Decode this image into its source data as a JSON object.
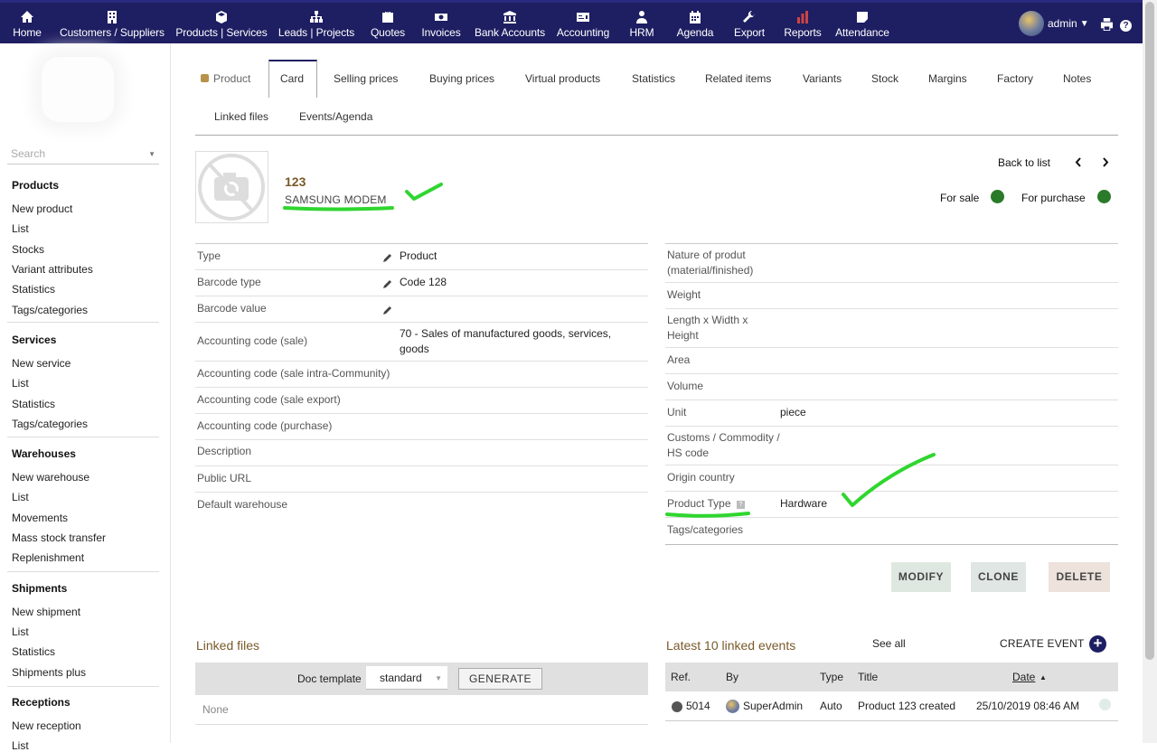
{
  "topnav": {
    "items": [
      {
        "label": "Home",
        "icon": "home-icon"
      },
      {
        "label": "Customers / Suppliers",
        "icon": "building-icon"
      },
      {
        "label": "Products | Services",
        "icon": "cube-icon"
      },
      {
        "label": "Leads | Projects",
        "icon": "sitemap-icon"
      },
      {
        "label": "Quotes",
        "icon": "suitcase-icon"
      },
      {
        "label": "Invoices",
        "icon": "money-bill-icon"
      },
      {
        "label": "Bank Accounts",
        "icon": "bank-icon"
      },
      {
        "label": "Accounting",
        "icon": "dollar-card-icon"
      },
      {
        "label": "HRM",
        "icon": "user-tie-icon"
      },
      {
        "label": "Agenda",
        "icon": "calendar-icon"
      },
      {
        "label": "Export",
        "icon": "wrench-icon"
      },
      {
        "label": "Reports",
        "icon": "chart-icon"
      },
      {
        "label": "Attendance",
        "icon": "sticky-note-icon"
      }
    ],
    "user": "admin",
    "bg_color": "#1e1e62"
  },
  "sidebar": {
    "search_placeholder": "Search",
    "groups": [
      {
        "title": "Products",
        "items": [
          "New product",
          "List",
          "Stocks",
          "Variant attributes",
          "Statistics",
          "Tags/categories"
        ]
      },
      {
        "title": "Services",
        "items": [
          "New service",
          "List",
          "Statistics",
          "Tags/categories"
        ]
      },
      {
        "title": "Warehouses",
        "items": [
          "New warehouse",
          "List",
          "Movements",
          "Mass stock transfer",
          "Replenishment"
        ]
      },
      {
        "title": "Shipments",
        "items": [
          "New shipment",
          "List",
          "Statistics",
          "Shipments plus"
        ]
      },
      {
        "title": "Receptions",
        "items": [
          "New reception",
          "List"
        ]
      }
    ]
  },
  "tabs": [
    "Product",
    "Card",
    "Selling prices",
    "Buying prices",
    "Virtual products",
    "Statistics",
    "Related items",
    "Variants",
    "Stock",
    "Margins",
    "Factory",
    "Notes",
    "Linked files",
    "Events/Agenda"
  ],
  "product": {
    "ref": "123",
    "label": "SAMSUNG MODEM",
    "back_to_list": "Back to list",
    "for_sale": "For sale",
    "for_purchase": "For purchase",
    "status_color": "#2a7a2a"
  },
  "left_fields": [
    {
      "label": "Type",
      "value": "Product"
    },
    {
      "label": "Barcode type",
      "value": "Code 128"
    },
    {
      "label": "Barcode value",
      "value": ""
    },
    {
      "label": "Accounting code (sale)",
      "value": "70 - Sales of manufactured goods, services, goods"
    },
    {
      "label": "Accounting code (sale intra-Community)",
      "value": ""
    },
    {
      "label": "Accounting code (sale export)",
      "value": ""
    },
    {
      "label": "Accounting code (purchase)",
      "value": ""
    },
    {
      "label": "Description",
      "value": ""
    },
    {
      "label": "Public URL",
      "value": ""
    },
    {
      "label": "Default warehouse",
      "value": ""
    }
  ],
  "right_fields": [
    {
      "label": "Nature of produt (material/finished)",
      "value": ""
    },
    {
      "label": "Weight",
      "value": ""
    },
    {
      "label": "Length x Width x Height",
      "value": ""
    },
    {
      "label": "Area",
      "value": ""
    },
    {
      "label": "Volume",
      "value": ""
    },
    {
      "label": "Unit",
      "value": "piece"
    },
    {
      "label": "Customs / Commodity / HS code",
      "value": ""
    },
    {
      "label": "Origin country",
      "value": ""
    },
    {
      "label": "Product Type",
      "value": "Hardware"
    },
    {
      "label": "Tags/categories",
      "value": ""
    }
  ],
  "actions": {
    "modify": "MODIFY",
    "clone": "CLONE",
    "delete": "DELETE"
  },
  "linked_files": {
    "title": "Linked files",
    "doc_template_label": "Doc template",
    "doc_template_value": "standard",
    "generate": "GENERATE",
    "empty": "None"
  },
  "events": {
    "title": "Latest 10 linked events",
    "see_all": "See all",
    "create": "CREATE EVENT",
    "columns": [
      "Ref.",
      "By",
      "Type",
      "Title",
      "Date"
    ],
    "rows": [
      {
        "ref": "5014",
        "by": "SuperAdmin",
        "type": "Auto",
        "title": "Product 123 created",
        "date": "25/10/2019 08:46 AM"
      }
    ]
  }
}
